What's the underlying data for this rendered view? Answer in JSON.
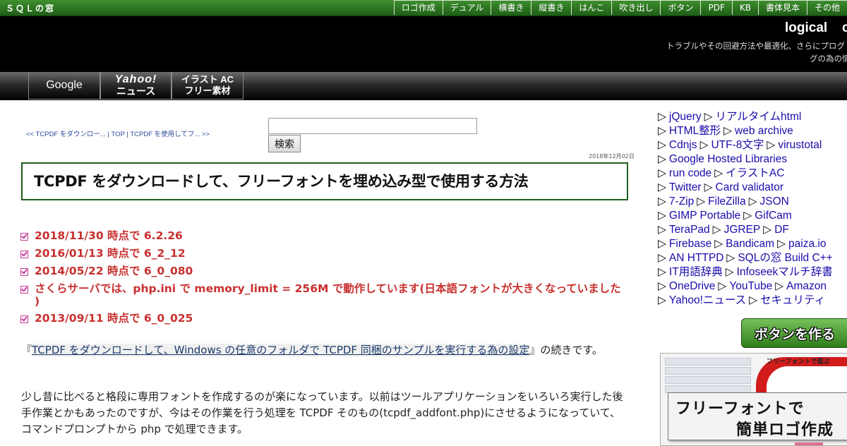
{
  "site": {
    "name": "ＳＱＬの窓"
  },
  "top_nav": [
    "ロゴ作成",
    "デュアル",
    "横書き",
    "縦書き",
    "はんこ",
    "吹き出し",
    "ボタン",
    "PDF",
    "KB",
    "書体見本",
    "その他"
  ],
  "header": {
    "brand": "logical",
    "brand_cut": "c",
    "tagline_line1": "トラブルやその回避方法や最適化、さらにプログ",
    "tagline_line2": "グの為の情"
  },
  "engines": {
    "google": "Google",
    "yahoo_top": "Yahoo!",
    "yahoo_bottom": "ニュース",
    "ac_top": "イラスト AC",
    "ac_bottom": "フリー素材"
  },
  "breadcrumb": {
    "prev": "<< TCPDF をダウンロー...",
    "sep1": " | ",
    "top": "TOP",
    "sep2": " | ",
    "next": "TCPDF を使用してフ... >>"
  },
  "search": {
    "value": "",
    "button_label": "検索"
  },
  "post": {
    "date": "2018年12月02日",
    "title": "TCPDF をダウンロードして、フリーフォントを埋め込み型で使用する方法",
    "versions": [
      "2018/11/30 時点で 6.2.26",
      "2016/01/13 時点で 6_2_12",
      "2014/05/22 時点で 6_0_080",
      "さくらサーバでは、php.ini で memory_limit = 256M で動作しています(日本語フォントが大きくなっていました )",
      "2013/09/11 時点で 6_0_025"
    ],
    "intro_open": "『",
    "intro_link": "TCPDF をダウンロードして、Windows の任意のフォルダで TCPDF 同梱のサンプルを実行する為の設定",
    "intro_rest": "』の続きです。",
    "paragraph2": "少し昔に比べると格段に専用フォントを作成するのが楽になっています。以前はツールアプリケーションをいろいろ実行した後手作業とかもあったのですが、今はその作業を行う処理を TCPDF そのもの(tcpdf_addfont.php)にさせるようになっていて、コマンドプロンプトから php で処理できます。"
  },
  "sidebar": {
    "rows": [
      [
        "jQuery",
        "リアルタイムhtml"
      ],
      [
        "HTML整形",
        "web archive"
      ],
      [
        "Cdnjs",
        "UTF-8文字",
        "virustotal"
      ],
      [
        "Google Hosted Libraries"
      ],
      [
        "run code",
        "イラストAC"
      ],
      [
        "Twitter",
        "Card validator"
      ],
      [
        "7-Zip",
        "FileZilla",
        "JSON"
      ],
      [
        "GIMP Portable",
        "GifCam"
      ],
      [
        "TeraPad",
        "JGREP",
        "DF"
      ],
      [
        "Firebase",
        "Bandicam",
        "paiza.io"
      ],
      [
        "AN HTTPD",
        "SQLの窓 Build C++"
      ],
      [
        "IT用語辞典",
        "Infoseekマルチ辞書"
      ],
      [
        "OneDrive",
        "YouTube",
        "Amazon"
      ],
      [
        "Yahoo!ニュース",
        "セキュリティ"
      ]
    ],
    "button_banner": "ボタンを作る",
    "logo_ad": {
      "top_text": "フリーフォントで遊ぶ",
      "caption_line1": "フリーフォントで",
      "caption_line2": "簡単ロゴ作成"
    }
  },
  "colors": {
    "top_bar": "#2e7a22",
    "header_bg": "#000000",
    "title_border": "#1f5f1f",
    "version_text": "#c8302f",
    "link": "#1a0dab"
  }
}
